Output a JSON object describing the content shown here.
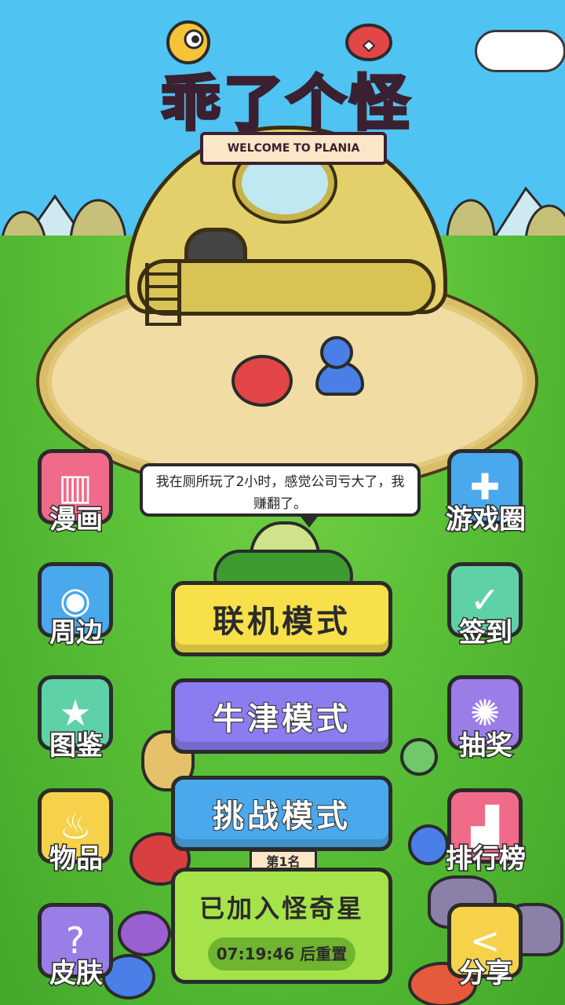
{
  "logo": {
    "title": "乖了个怪",
    "subtitle": "WELCOME TO PLANIA"
  },
  "speech": {
    "text": "我在厕所玩了2小时，感觉公司亏大了，我赚翻了。"
  },
  "left_menu": [
    {
      "id": "manga",
      "label": "漫画",
      "icon": "cat-book-icon",
      "color": "#f06b8a"
    },
    {
      "id": "merch",
      "label": "周边",
      "icon": "monster-face-icon",
      "color": "#4aa8ec"
    },
    {
      "id": "collection",
      "label": "图鉴",
      "icon": "star-book-icon",
      "color": "#5fd1a6"
    },
    {
      "id": "items",
      "label": "物品",
      "icon": "bag-icon",
      "color": "#f5d24a"
    },
    {
      "id": "skins",
      "label": "皮肤",
      "icon": "shirt-icon",
      "color": "#9b7de8"
    }
  ],
  "right_menu": [
    {
      "id": "game_circle",
      "label": "游戏圈",
      "icon": "gamepad-icon",
      "color": "#4aa8ec"
    },
    {
      "id": "checkin",
      "label": "签到",
      "icon": "calendar-check-icon",
      "color": "#5fd1a6"
    },
    {
      "id": "lottery",
      "label": "抽奖",
      "icon": "wheel-icon",
      "color": "#9b7de8"
    },
    {
      "id": "leaderboard",
      "label": "排行榜",
      "icon": "podium-icon",
      "color": "#f06b8a"
    },
    {
      "id": "share",
      "label": "分享",
      "icon": "share-icon",
      "color": "#f5d24a"
    }
  ],
  "modes": [
    {
      "id": "online",
      "label": "联机模式",
      "color": "#f7e04a"
    },
    {
      "id": "oxford",
      "label": "牛津模式",
      "color": "#8b7cf0"
    },
    {
      "id": "challenge",
      "label": "挑战模式",
      "color": "#4aa8ec"
    }
  ],
  "join": {
    "title": "已加入怪奇星",
    "timer": "07:19:46 后重置"
  },
  "ladder_sign": "第1名"
}
